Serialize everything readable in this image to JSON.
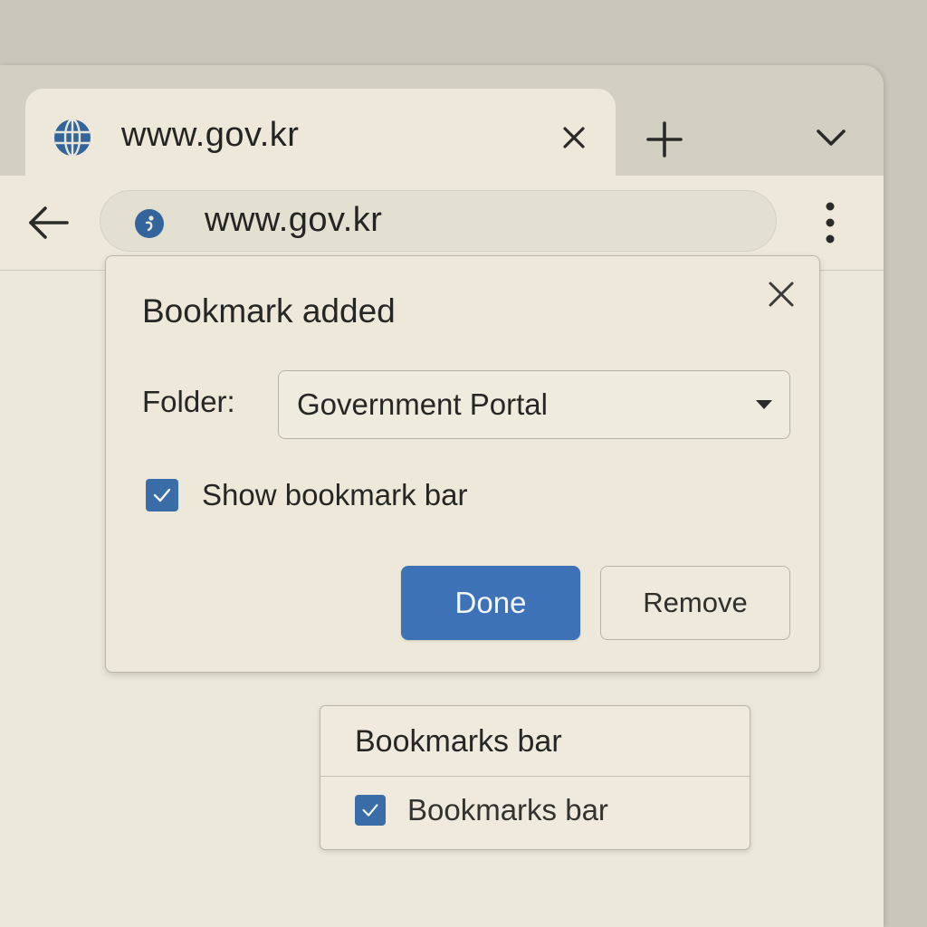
{
  "tab": {
    "title": "www.gov.kr",
    "favicon": "globe-icon"
  },
  "toolbar": {
    "url": "www.gov.kr",
    "site_icon": "site-info-icon"
  },
  "dialog": {
    "title": "Bookmark added",
    "folder_label": "Folder:",
    "folder_value": "Government Portal",
    "show_bar_label": "Show bookmark bar",
    "show_bar_checked": true,
    "done_label": "Done",
    "remove_label": "Remove"
  },
  "bookmarks_popup": {
    "header": "Bookmarks bar",
    "item_label": "Bookmarks bar",
    "item_checked": true
  },
  "colors": {
    "accent": "#3d73b6",
    "checkbox": "#3a6da7",
    "surface": "#ede8da",
    "frame": "#d3d0c3"
  }
}
